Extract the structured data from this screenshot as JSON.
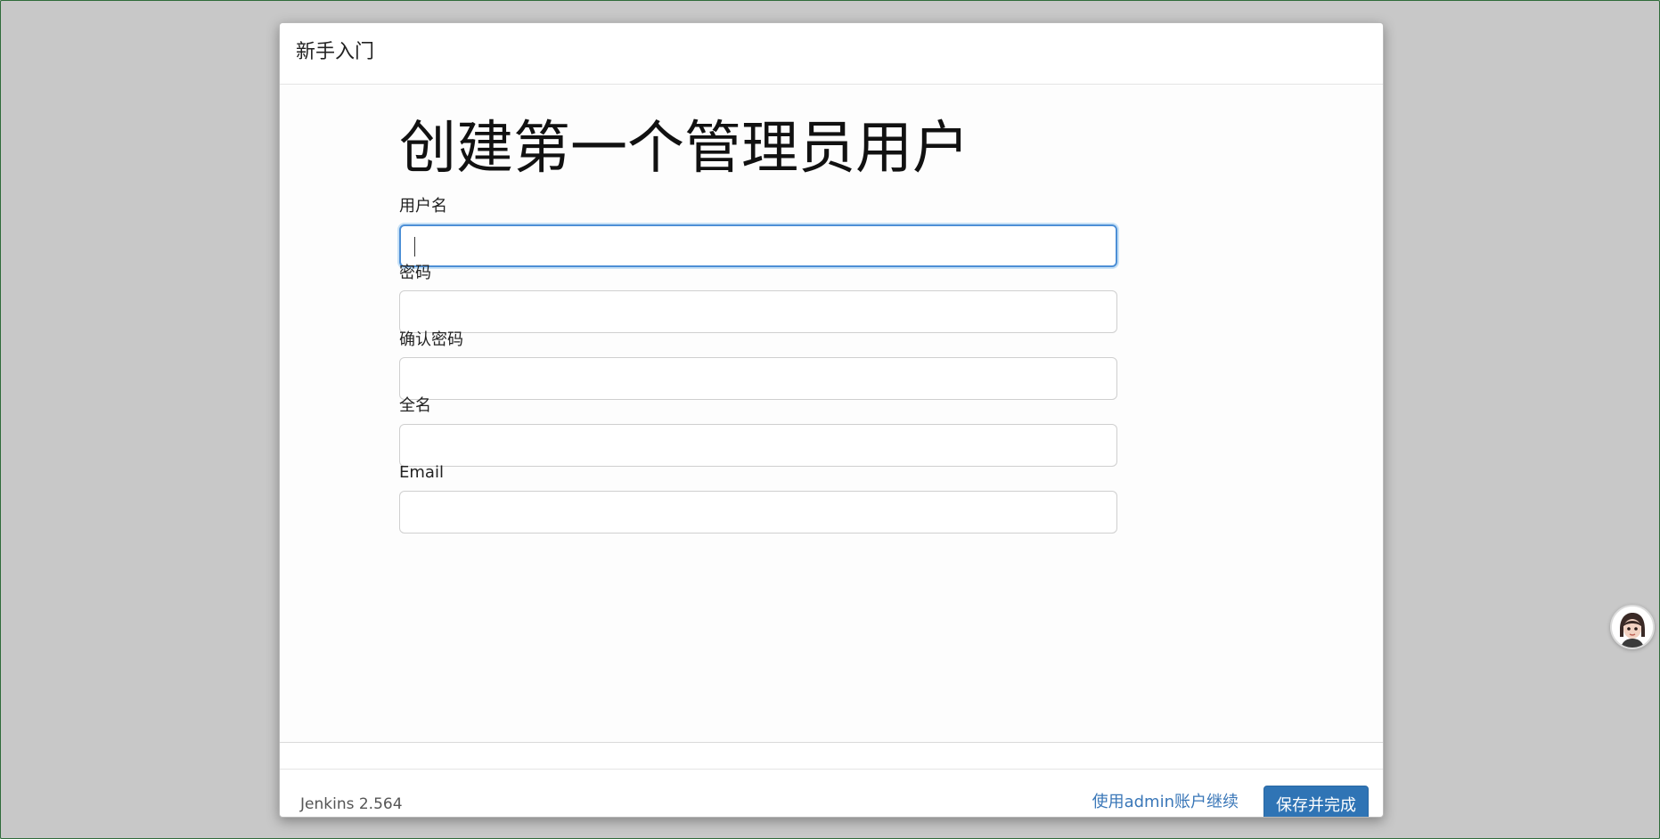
{
  "dialog": {
    "title": "新手入门"
  },
  "form": {
    "heading": "创建第一个管理员用户",
    "fields": [
      {
        "label": "用户名",
        "value": ""
      },
      {
        "label": "密码",
        "value": ""
      },
      {
        "label": "确认密码",
        "value": ""
      },
      {
        "label": "全名",
        "value": ""
      },
      {
        "label": "Email",
        "value": ""
      }
    ]
  },
  "footer": {
    "version": "Jenkins 2.564",
    "continue_as_admin": "使用admin账户继续",
    "save_finish": "保存并完成"
  },
  "colors": {
    "accent": "#2f74b5",
    "link": "#3a77b8",
    "focus": "#4d8fd6",
    "backdrop": "#c8c8c8"
  },
  "icons": {
    "assistant": "assistant-avatar-icon"
  }
}
